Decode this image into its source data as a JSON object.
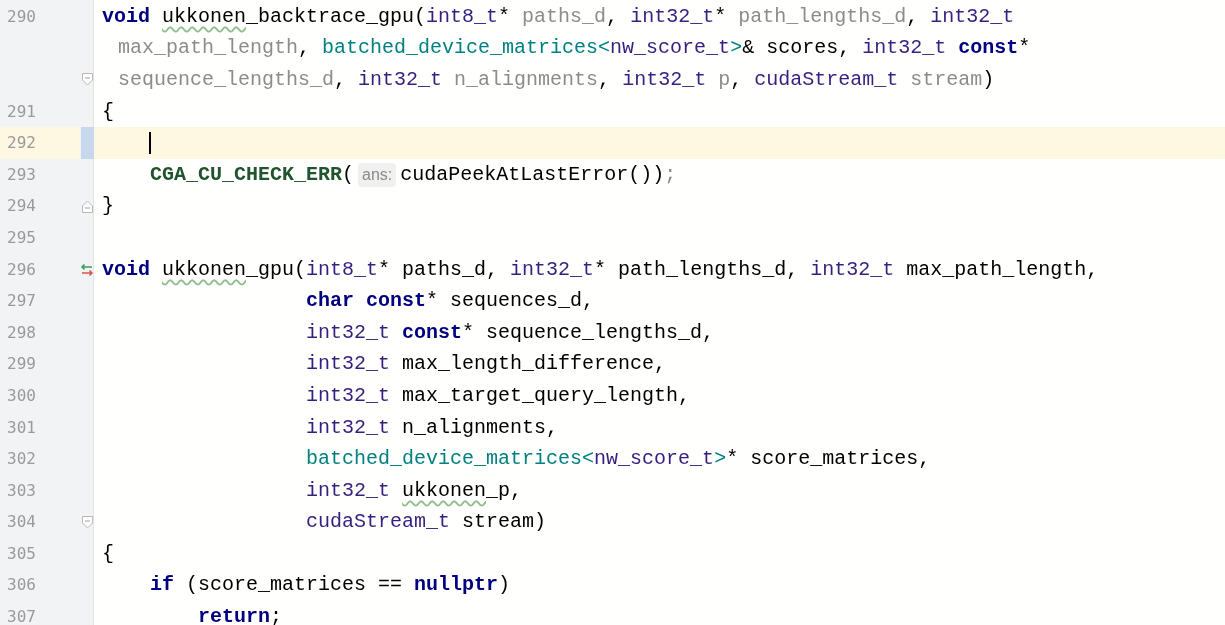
{
  "editor": {
    "rows": [
      {
        "kind": "line",
        "number": "290",
        "current": false,
        "caret": false,
        "tokens": [
          {
            "kind": "keyword",
            "text": "void "
          },
          {
            "kind": "typo",
            "text": "ukkonen"
          },
          {
            "kind": "plain",
            "text": "_backtrace_gpu("
          },
          {
            "kind": "type",
            "text": "int8_t"
          },
          {
            "kind": "plain",
            "text": "* "
          },
          {
            "kind": "unused",
            "text": "paths_d"
          },
          {
            "kind": "plain",
            "text": ", "
          },
          {
            "kind": "type",
            "text": "int32_t"
          },
          {
            "kind": "plain",
            "text": "* "
          },
          {
            "kind": "unused",
            "text": "path_lengths_d"
          },
          {
            "kind": "plain",
            "text": ", "
          },
          {
            "kind": "type",
            "text": "int32_t"
          }
        ]
      },
      {
        "kind": "wrap",
        "tokens": [
          {
            "kind": "unused",
            "text": "max_path_length"
          },
          {
            "kind": "plain",
            "text": ", "
          },
          {
            "kind": "class",
            "text": "batched_device_matrices<"
          },
          {
            "kind": "type",
            "text": "nw_score_t"
          },
          {
            "kind": "class",
            "text": ">"
          },
          {
            "kind": "plain",
            "text": "& scores, "
          },
          {
            "kind": "type",
            "text": "int32_t "
          },
          {
            "kind": "keyword",
            "text": "const"
          },
          {
            "kind": "plain",
            "text": "*"
          }
        ]
      },
      {
        "kind": "wrap",
        "marker": {
          "kind": "fold"
        },
        "tokens": [
          {
            "kind": "unused",
            "text": "sequence_lengths_d"
          },
          {
            "kind": "plain",
            "text": ", "
          },
          {
            "kind": "type",
            "text": "int32_t "
          },
          {
            "kind": "unused",
            "text": "n_alignments"
          },
          {
            "kind": "plain",
            "text": ", "
          },
          {
            "kind": "type",
            "text": "int32_t "
          },
          {
            "kind": "unused",
            "text": "p"
          },
          {
            "kind": "plain",
            "text": ", "
          },
          {
            "kind": "type",
            "text": "cudaStream_t "
          },
          {
            "kind": "unused",
            "text": "stream"
          },
          {
            "kind": "plain",
            "text": ")"
          }
        ]
      },
      {
        "kind": "line",
        "number": "291",
        "current": false,
        "caret": false,
        "tokens": [
          {
            "kind": "plain",
            "text": "{"
          }
        ]
      },
      {
        "kind": "line",
        "number": "292",
        "current": true,
        "caret": true,
        "tokens": []
      },
      {
        "kind": "line",
        "number": "293",
        "current": false,
        "caret": false,
        "tokens": [
          {
            "kind": "macro",
            "text": "    CGA_CU_CHECK_ERR"
          },
          {
            "kind": "plain",
            "text": "("
          },
          {
            "kind": "hint",
            "text": "ans:"
          },
          {
            "kind": "plain",
            "text": "cudaPeekAtLastError())"
          },
          {
            "kind": "dim",
            "text": ";"
          }
        ]
      },
      {
        "kind": "line",
        "number": "294",
        "marker": {
          "kind": "fold_end"
        },
        "current": false,
        "caret": false,
        "tokens": [
          {
            "kind": "plain",
            "text": "}"
          }
        ]
      },
      {
        "kind": "line",
        "number": "295",
        "current": false,
        "caret": false,
        "tokens": []
      },
      {
        "kind": "line",
        "number": "296",
        "marker": {
          "kind": "override"
        },
        "current": false,
        "caret": false,
        "tokens": [
          {
            "kind": "keyword",
            "text": "void "
          },
          {
            "kind": "typo",
            "text": "ukkonen"
          },
          {
            "kind": "plain",
            "text": "_gpu("
          },
          {
            "kind": "type",
            "text": "int8_t"
          },
          {
            "kind": "plain",
            "text": "* paths_d, "
          },
          {
            "kind": "type",
            "text": "int32_t"
          },
          {
            "kind": "plain",
            "text": "* path_lengths_d, "
          },
          {
            "kind": "type",
            "text": "int32_t"
          },
          {
            "kind": "plain",
            "text": " max_path_length,"
          }
        ]
      },
      {
        "kind": "line",
        "number": "297",
        "current": false,
        "caret": false,
        "tokens": [
          {
            "kind": "keyword",
            "text": "                 char const"
          },
          {
            "kind": "plain",
            "text": "* sequences_d,"
          }
        ]
      },
      {
        "kind": "line",
        "number": "298",
        "current": false,
        "caret": false,
        "tokens": [
          {
            "kind": "type",
            "text": "                 int32_t "
          },
          {
            "kind": "keyword",
            "text": "const"
          },
          {
            "kind": "plain",
            "text": "* sequence_lengths_d,"
          }
        ]
      },
      {
        "kind": "line",
        "number": "299",
        "current": false,
        "caret": false,
        "tokens": [
          {
            "kind": "type",
            "text": "                 int32_t"
          },
          {
            "kind": "plain",
            "text": " max_length_difference,"
          }
        ]
      },
      {
        "kind": "line",
        "number": "300",
        "current": false,
        "caret": false,
        "tokens": [
          {
            "kind": "type",
            "text": "                 int32_t"
          },
          {
            "kind": "plain",
            "text": " max_target_query_length,"
          }
        ]
      },
      {
        "kind": "line",
        "number": "301",
        "current": false,
        "caret": false,
        "tokens": [
          {
            "kind": "type",
            "text": "                 int32_t"
          },
          {
            "kind": "plain",
            "text": " n_alignments,"
          }
        ]
      },
      {
        "kind": "line",
        "number": "302",
        "current": false,
        "caret": false,
        "tokens": [
          {
            "kind": "class",
            "text": "                 batched_device_matrices<"
          },
          {
            "kind": "type",
            "text": "nw_score_t"
          },
          {
            "kind": "class",
            "text": ">"
          },
          {
            "kind": "plain",
            "text": "* score_matrices,"
          }
        ]
      },
      {
        "kind": "line",
        "number": "303",
        "current": false,
        "caret": false,
        "tokens": [
          {
            "kind": "type",
            "text": "                 int32_t "
          },
          {
            "kind": "typo",
            "text": "ukkonen"
          },
          {
            "kind": "plain",
            "text": "_p,"
          }
        ]
      },
      {
        "kind": "line",
        "number": "304",
        "marker": {
          "kind": "fold"
        },
        "current": false,
        "caret": false,
        "tokens": [
          {
            "kind": "type",
            "text": "                 cudaStream_t"
          },
          {
            "kind": "plain",
            "text": " stream)"
          }
        ]
      },
      {
        "kind": "line",
        "number": "305",
        "current": false,
        "caret": false,
        "tokens": [
          {
            "kind": "plain",
            "text": "{"
          }
        ]
      },
      {
        "kind": "line",
        "number": "306",
        "current": false,
        "caret": false,
        "tokens": [
          {
            "kind": "keyword",
            "text": "    if"
          },
          {
            "kind": "plain",
            "text": " (score_matrices == "
          },
          {
            "kind": "keyword",
            "text": "nullptr"
          },
          {
            "kind": "plain",
            "text": ")"
          }
        ]
      },
      {
        "kind": "line",
        "number": "307",
        "current": false,
        "caret": false,
        "tokens": [
          {
            "kind": "keyword",
            "text": "        return"
          },
          {
            "kind": "plain",
            "text": ";"
          }
        ]
      }
    ]
  }
}
